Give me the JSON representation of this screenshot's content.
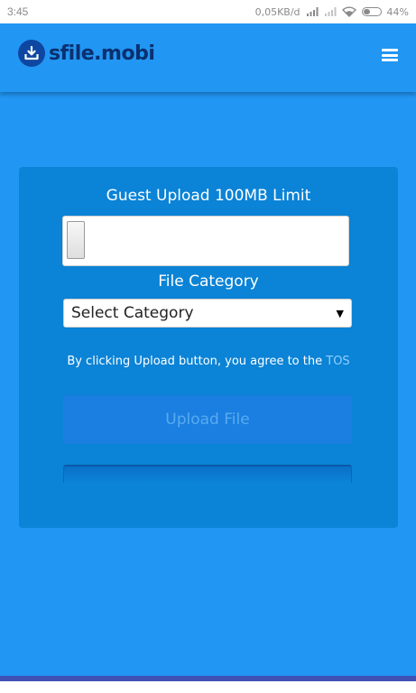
{
  "status_bar": {
    "time": "3:45",
    "network_speed": "0,05KB/d",
    "battery_percent": "44%",
    "battery_level": 0.44
  },
  "header": {
    "logo_text": "sfile.mobi",
    "logo_icon": "download-tray-icon",
    "menu_icon": "hamburger-menu-icon"
  },
  "upload_form": {
    "title": "Guest Upload 100MB Limit",
    "category_label": "File Category",
    "category_selected": "Select Category",
    "tos_text": "By clicking Upload button, you agree to the",
    "tos_link": "TOS",
    "upload_button_label": "Upload File"
  },
  "colors": {
    "background": "#2196f3",
    "card": "#0b83d6",
    "logo_dark": "#0b2f6e",
    "link": "#8fd0ff"
  }
}
